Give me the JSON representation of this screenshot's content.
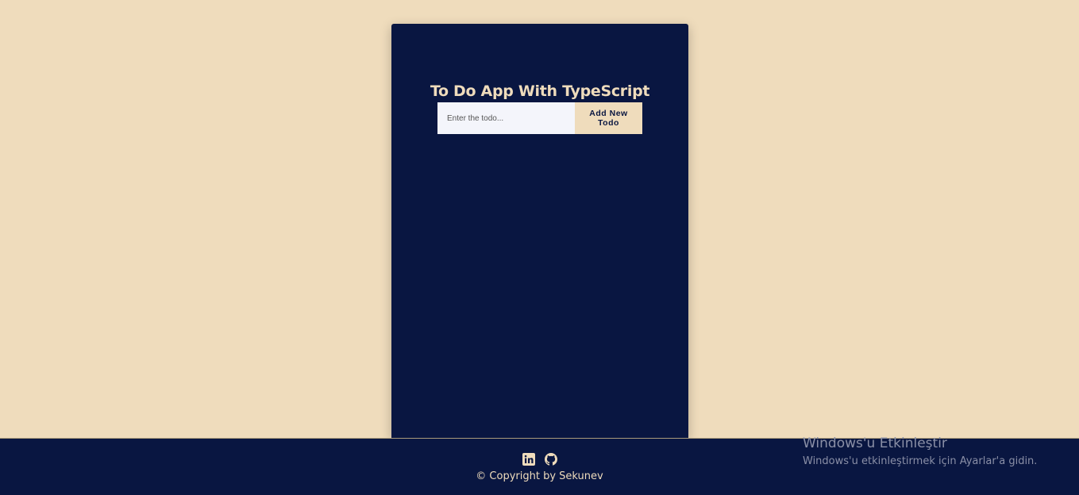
{
  "app": {
    "title": "To Do App With TypeScript"
  },
  "form": {
    "input_placeholder": "Enter the todo...",
    "input_value": "",
    "add_button_label_line1": "Add New",
    "add_button_label_line2": "Todo"
  },
  "footer": {
    "icons": [
      "linkedin-icon",
      "github-icon"
    ],
    "copyright": "© Copyright by Sekunev"
  },
  "windows_watermark": {
    "title": "Windows'u Etkinleştir",
    "subtitle": "Windows'u etkinleştirmek için Ayarlar'a gidin."
  },
  "colors": {
    "background": "#efdcbc",
    "card": "#091641",
    "accent": "#efdcbc",
    "input_bg": "#f4f5fb"
  }
}
